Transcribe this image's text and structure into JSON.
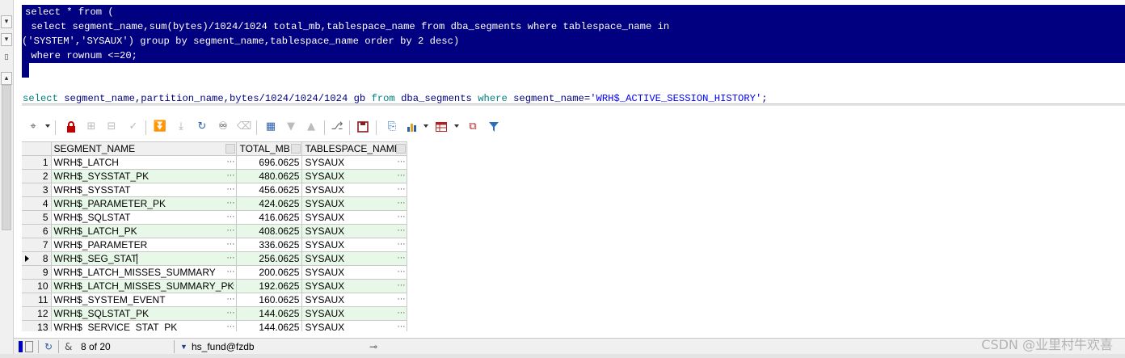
{
  "editor": {
    "query1_lines": [
      "select * from (",
      " select segment_name,sum(bytes)/1024/1024 total_mb,tablespace_name from dba_segments where tablespace_name in",
      "('SYSTEM','SYSAUX') group by segment_name,tablespace_name order by 2 desc)",
      " where rownum <=20;"
    ],
    "query2": {
      "kw_select": "select",
      "p1": " segment_name,partition_name,bytes/1024/1024/1024 gb ",
      "kw_from": "from",
      "p2": " dba_segments ",
      "kw_where": "where",
      "p3": " segment_name=",
      "str": "'WRH$_ACTIVE_SESSION_HISTORY'",
      "end": ";"
    },
    "selection_color": "#000080"
  },
  "toolbar": {
    "icons": [
      "select-columns-icon",
      "lock-icon",
      "new-record-icon",
      "delete-record-icon",
      "post-changes-icon",
      "fetch-next-icon",
      "fetch-last-icon",
      "refresh-icon",
      "find-icon",
      "clear-icon",
      "single-record-view-icon",
      "sort-desc-icon",
      "sort-asc-icon",
      "query-by-example-icon",
      "save-icon",
      "export-icon",
      "chart-icon",
      "grid-table-icon",
      "compare-icon",
      "filter-icon"
    ]
  },
  "grid": {
    "columns": [
      "SEGMENT_NAME",
      "TOTAL_MB",
      "TABLESPACE_NAME"
    ],
    "current_row": 8,
    "rows": [
      {
        "n": "1",
        "segment_name": "WRH$_LATCH",
        "total_mb": "696.0625",
        "tablespace_name": "SYSAUX"
      },
      {
        "n": "2",
        "segment_name": "WRH$_SYSSTAT_PK",
        "total_mb": "480.0625",
        "tablespace_name": "SYSAUX"
      },
      {
        "n": "3",
        "segment_name": "WRH$_SYSSTAT",
        "total_mb": "456.0625",
        "tablespace_name": "SYSAUX"
      },
      {
        "n": "4",
        "segment_name": "WRH$_PARAMETER_PK",
        "total_mb": "424.0625",
        "tablespace_name": "SYSAUX"
      },
      {
        "n": "5",
        "segment_name": "WRH$_SQLSTAT",
        "total_mb": "416.0625",
        "tablespace_name": "SYSAUX"
      },
      {
        "n": "6",
        "segment_name": "WRH$_LATCH_PK",
        "total_mb": "408.0625",
        "tablespace_name": "SYSAUX"
      },
      {
        "n": "7",
        "segment_name": "WRH$_PARAMETER",
        "total_mb": "336.0625",
        "tablespace_name": "SYSAUX"
      },
      {
        "n": "8",
        "segment_name": "WRH$_SEG_STAT",
        "total_mb": "256.0625",
        "tablespace_name": "SYSAUX"
      },
      {
        "n": "9",
        "segment_name": "WRH$_LATCH_MISSES_SUMMARY",
        "total_mb": "200.0625",
        "tablespace_name": "SYSAUX"
      },
      {
        "n": "10",
        "segment_name": "WRH$_LATCH_MISSES_SUMMARY_PK",
        "total_mb": "192.0625",
        "tablespace_name": "SYSAUX"
      },
      {
        "n": "11",
        "segment_name": "WRH$_SYSTEM_EVENT",
        "total_mb": "160.0625",
        "tablespace_name": "SYSAUX"
      },
      {
        "n": "12",
        "segment_name": "WRH$_SQLSTAT_PK",
        "total_mb": "144.0625",
        "tablespace_name": "SYSAUX"
      },
      {
        "n": "13",
        "segment_name": "WRH$_SERVICE_STAT_PK",
        "total_mb": "144.0625",
        "tablespace_name": "SYSAUX"
      }
    ]
  },
  "statusbar": {
    "record_position": "8 of 20",
    "connection": "hs_fund@fzdb"
  },
  "watermark": "CSDN @业里村牛欢喜"
}
